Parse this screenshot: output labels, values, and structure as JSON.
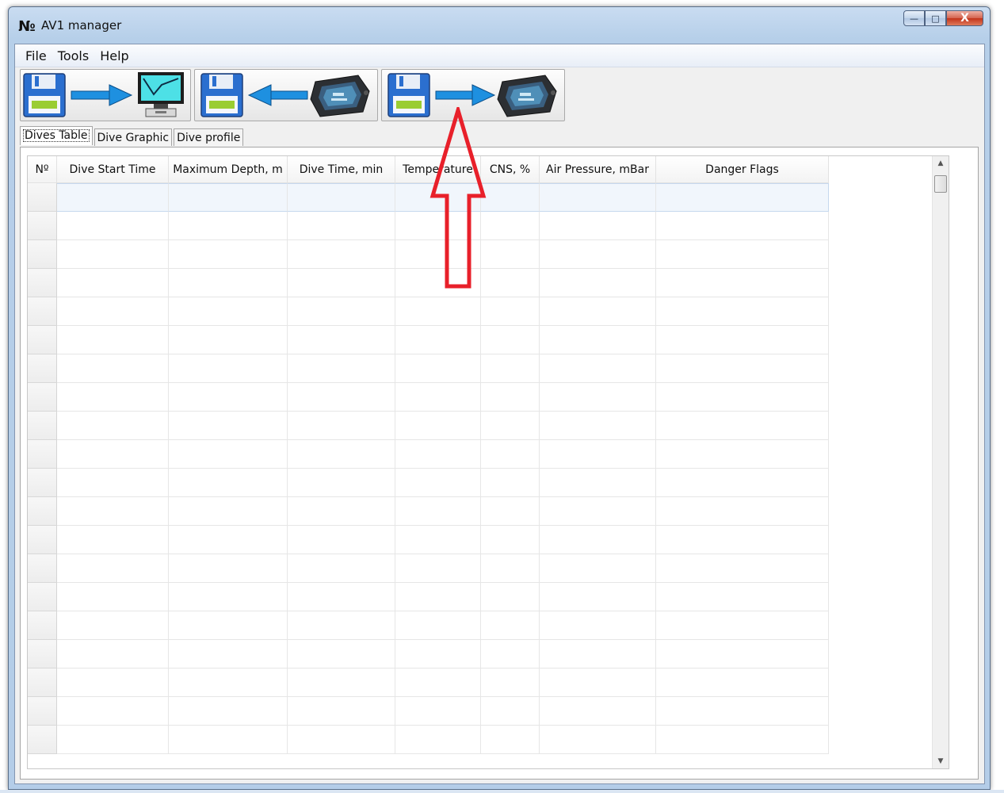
{
  "window": {
    "title": "AV1 manager",
    "icon_glyph": "№",
    "icon": "app-logo-icon",
    "minimize_glyph": "—",
    "maximize_glyph": "□",
    "close_glyph": "X"
  },
  "menu": {
    "items": [
      {
        "label": "File"
      },
      {
        "label": "Tools"
      },
      {
        "label": "Help"
      }
    ]
  },
  "toolbar": {
    "buttons": [
      {
        "icon": "floppy-to-monitor-icon"
      },
      {
        "icon": "dive-computer-to-floppy-icon"
      },
      {
        "icon": "floppy-to-dive-computer-icon"
      }
    ]
  },
  "tabs": {
    "items": [
      {
        "label": "Dives Table",
        "active": true
      },
      {
        "label": "Dive Graphic",
        "active": false
      },
      {
        "label": "Dive profile",
        "active": false
      }
    ]
  },
  "table": {
    "columns": [
      {
        "label": "Nº"
      },
      {
        "label": "Dive Start Time"
      },
      {
        "label": "Maximum Depth, m"
      },
      {
        "label": "Dive Time, min"
      },
      {
        "label": "Temperature"
      },
      {
        "label": "CNS, %"
      },
      {
        "label": "Air Pressure, mBar"
      },
      {
        "label": "Danger Flags"
      }
    ],
    "rows": [],
    "selected_row": 0
  },
  "colors": {
    "annotation_arrow": "#e8202a",
    "arrow_blue": "#1e90e0",
    "floppy_blue": "#2b6fcf",
    "floppy_label": "#9acd32"
  }
}
